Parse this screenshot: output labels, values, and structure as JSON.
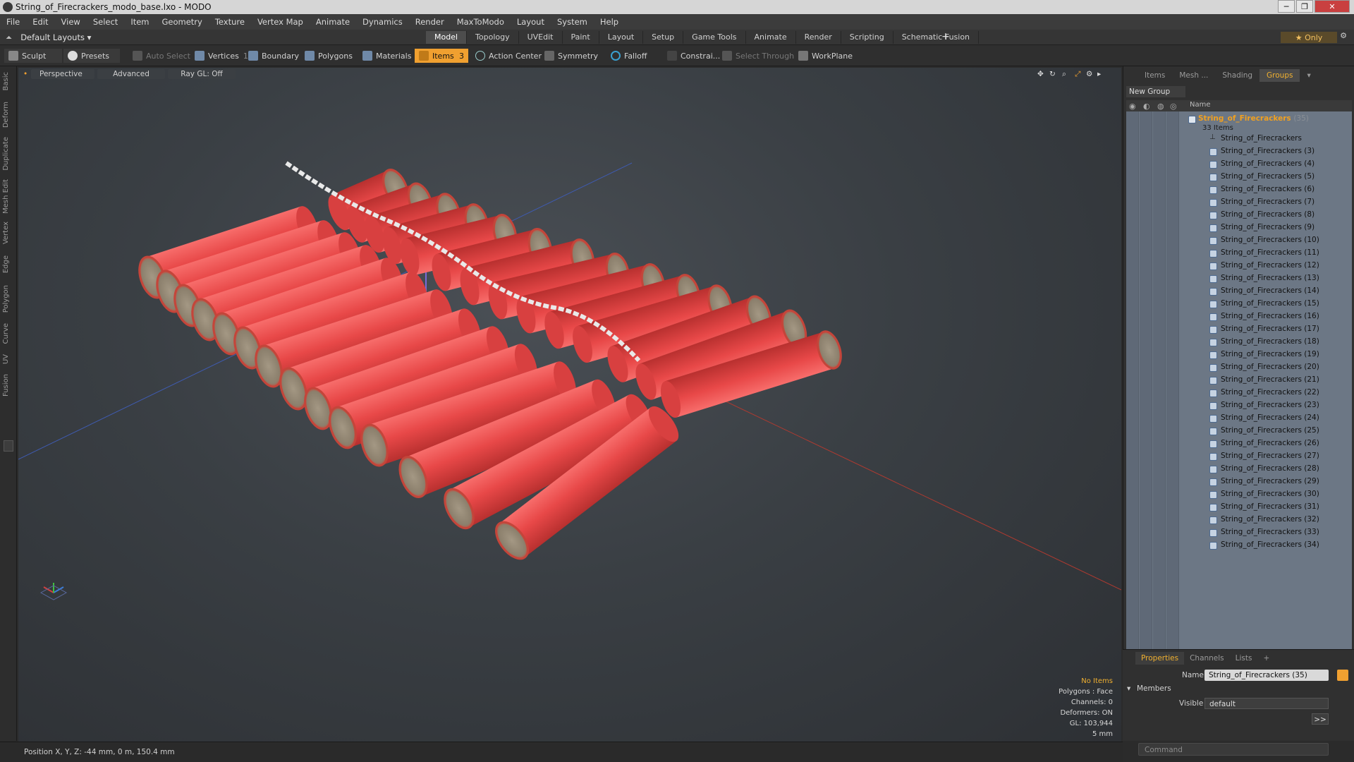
{
  "window": {
    "title": "String_of_Firecrackers_modo_base.lxo - MODO",
    "min": "─",
    "max": "❐",
    "close": "✕"
  },
  "menu": [
    "File",
    "Edit",
    "View",
    "Select",
    "Item",
    "Geometry",
    "Texture",
    "Vertex Map",
    "Animate",
    "Dynamics",
    "Render",
    "MaxToModo",
    "Layout",
    "System",
    "Help"
  ],
  "layout": {
    "dropdown": "Default Layouts ▾",
    "tabs": [
      "Model",
      "Topology",
      "UVEdit",
      "Paint",
      "Layout",
      "Setup",
      "Game Tools",
      "Animate",
      "Render",
      "Scripting",
      "Schematic Fusion"
    ],
    "active_tab": "Model",
    "plus": "+",
    "only": "★ Only"
  },
  "toolbar": {
    "sculpt": "Sculpt",
    "presets": "Presets",
    "auto_select": "Auto Select",
    "vertices": "Vertices",
    "vertices_count": "1",
    "boundary": "Boundary",
    "polygons": "Polygons",
    "materials": "Materials",
    "items": "Items",
    "items_count": "3",
    "action_center": "Action Center",
    "symmetry": "Symmetry",
    "falloff": "Falloff",
    "constrain": "Constrai...",
    "select_through": "Select Through",
    "workplane": "WorkPlane"
  },
  "left_tabs": [
    "Basic",
    "Deform",
    "Duplicate",
    "Mesh Edit",
    "Vertex",
    "Edge",
    "Polygon",
    "Curve",
    "UV",
    "Fusion"
  ],
  "viewport": {
    "view": "Perspective",
    "mode": "Advanced",
    "raygl": "Ray GL: Off",
    "info": {
      "no_items": "No Items",
      "polygons": "Polygons : Face",
      "channels": "Channels: 0",
      "deformers": "Deformers: ON",
      "gl": "GL: 103,944",
      "scale": "5 mm"
    }
  },
  "right_panel": {
    "tabs": [
      "Items",
      "Mesh ...",
      "Shading",
      "Groups"
    ],
    "active_tab": "Groups",
    "new_group": "New Group",
    "col_name": "Name",
    "root_name": "String_of_Firecrackers",
    "root_count": "(35)",
    "items_count": "33 Items",
    "items": [
      "String_of_Firecrackers",
      "String_of_Firecrackers (3)",
      "String_of_Firecrackers (4)",
      "String_of_Firecrackers (5)",
      "String_of_Firecrackers (6)",
      "String_of_Firecrackers (7)",
      "String_of_Firecrackers (8)",
      "String_of_Firecrackers (9)",
      "String_of_Firecrackers (10)",
      "String_of_Firecrackers (11)",
      "String_of_Firecrackers (12)",
      "String_of_Firecrackers (13)",
      "String_of_Firecrackers (14)",
      "String_of_Firecrackers (15)",
      "String_of_Firecrackers (16)",
      "String_of_Firecrackers (17)",
      "String_of_Firecrackers (18)",
      "String_of_Firecrackers (19)",
      "String_of_Firecrackers (20)",
      "String_of_Firecrackers (21)",
      "String_of_Firecrackers (22)",
      "String_of_Firecrackers (23)",
      "String_of_Firecrackers (24)",
      "String_of_Firecrackers (25)",
      "String_of_Firecrackers (26)",
      "String_of_Firecrackers (27)",
      "String_of_Firecrackers (28)",
      "String_of_Firecrackers (29)",
      "String_of_Firecrackers (30)",
      "String_of_Firecrackers (31)",
      "String_of_Firecrackers (32)",
      "String_of_Firecrackers (33)",
      "String_of_Firecrackers (34)"
    ]
  },
  "properties": {
    "tabs": [
      "Properties",
      "Channels",
      "Lists",
      "+"
    ],
    "active_tab": "Properties",
    "name_label": "Name",
    "name_value": "String_of_Firecrackers (35)",
    "members": "Members",
    "visible_label": "Visible",
    "visible_value": "default",
    "more": ">>",
    "command_placeholder": "Command"
  },
  "status": {
    "position": "Position X, Y, Z:  -44 mm, 0 m, 150.4 mm"
  },
  "colors": {
    "accent": "#f0a030",
    "firecracker": "#e8474a",
    "tree_bg": "#6c7785"
  }
}
